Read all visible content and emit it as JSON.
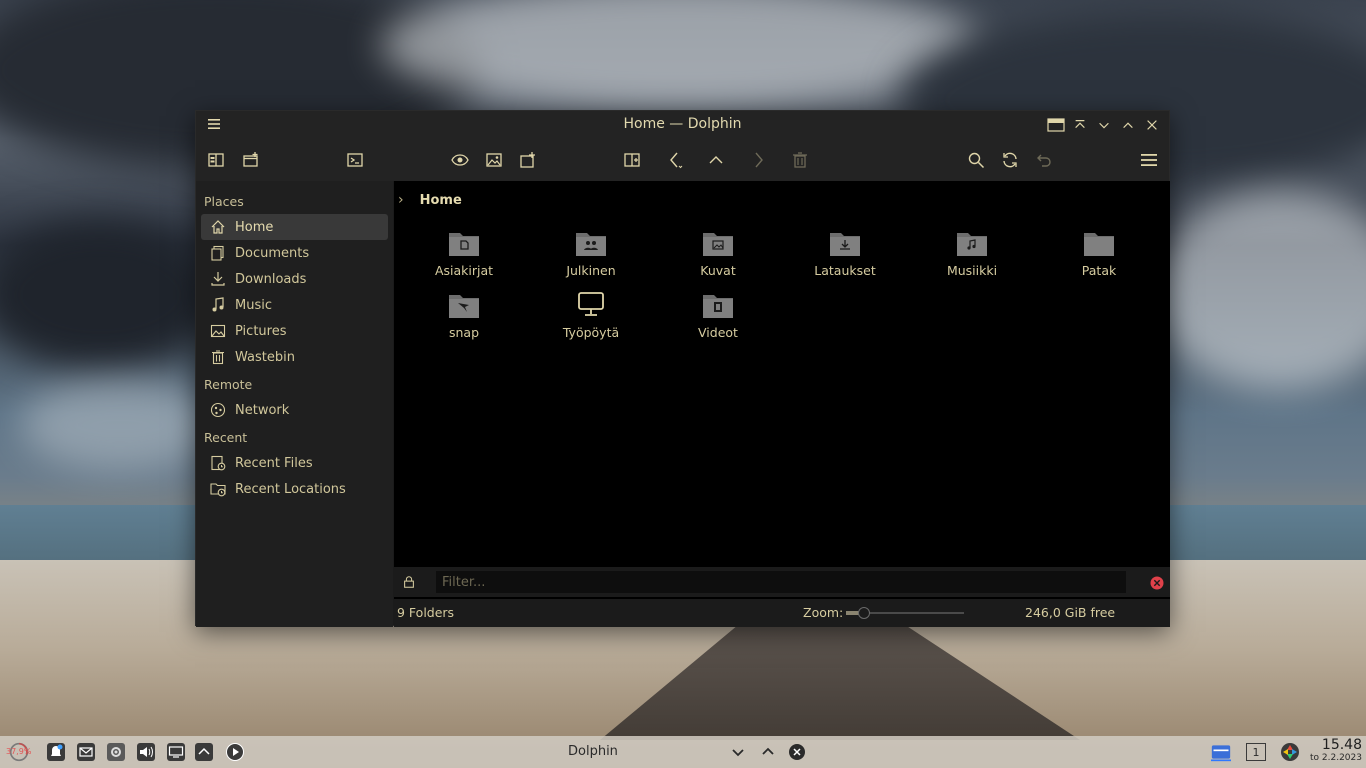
{
  "window": {
    "title": "Home — Dolphin"
  },
  "sidebar": {
    "sections": [
      {
        "label": "Places",
        "items": [
          {
            "label": "Home",
            "icon": "home-icon",
            "active": true
          },
          {
            "label": "Documents",
            "icon": "documents-icon"
          },
          {
            "label": "Downloads",
            "icon": "downloads-icon"
          },
          {
            "label": "Music",
            "icon": "music-icon"
          },
          {
            "label": "Pictures",
            "icon": "pictures-icon"
          },
          {
            "label": "Wastebin",
            "icon": "trash-icon"
          }
        ]
      },
      {
        "label": "Remote",
        "items": [
          {
            "label": "Network",
            "icon": "network-icon"
          }
        ]
      },
      {
        "label": "Recent",
        "items": [
          {
            "label": "Recent Files",
            "icon": "recent-files-icon"
          },
          {
            "label": "Recent Locations",
            "icon": "recent-locations-icon"
          }
        ]
      }
    ]
  },
  "breadcrumb": {
    "current": "Home"
  },
  "folders": [
    {
      "name": "Asiakirjat",
      "icon": "document-folder-icon"
    },
    {
      "name": "Julkinen",
      "icon": "public-folder-icon"
    },
    {
      "name": "Kuvat",
      "icon": "pictures-folder-icon"
    },
    {
      "name": "Lataukset",
      "icon": "downloads-folder-icon"
    },
    {
      "name": "Musiikki",
      "icon": "music-folder-icon"
    },
    {
      "name": "Patak",
      "icon": "folder-icon"
    },
    {
      "name": "snap",
      "icon": "snap-folder-icon"
    },
    {
      "name": "Työpöytä",
      "icon": "desktop-icon"
    },
    {
      "name": "Videot",
      "icon": "videos-folder-icon"
    }
  ],
  "filter": {
    "placeholder": "Filter..."
  },
  "status": {
    "count": "9 Folders",
    "zoom_label": "Zoom:",
    "zoom_level": 0.15,
    "free_space": "246,0 GiB free"
  },
  "taskbar": {
    "cpu": "37,9%",
    "active_window": "Dolphin",
    "desktop_number": "1",
    "time": "15.48",
    "date": "to 2.2.2023"
  },
  "colors": {
    "accent_text": "#e6dcb0",
    "window_bg": "#1b1b1b",
    "view_bg": "#000000",
    "close_red": "#e0414a"
  }
}
